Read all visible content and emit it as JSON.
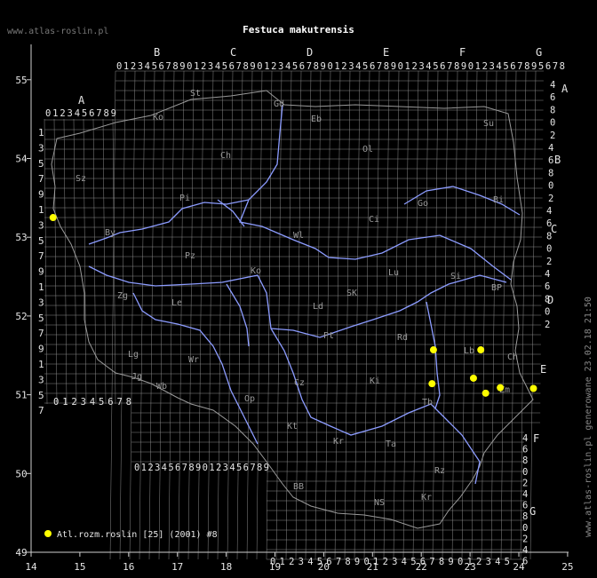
{
  "title": "Festuca makutrensis",
  "site": "www.atlas-roslin.pl",
  "credit": "www.atlas-roslin.pl generowane 23.02.18 21:50",
  "axes": {
    "x_ticks": [
      "14",
      "15",
      "16",
      "17",
      "18",
      "19",
      "20",
      "21",
      "22",
      "23",
      "24",
      "25"
    ],
    "y_ticks": [
      "55",
      "54",
      "53",
      "52",
      "51",
      "50",
      "49"
    ]
  },
  "grid_columns": {
    "top_letters": [
      "B",
      "C",
      "D",
      "E",
      "F",
      "G"
    ],
    "left_letter": "A",
    "digits": "0123456789",
    "top_tail": "5678",
    "left_tail": "012345678",
    "bottom_digits": "01234567890123456789",
    "bottom_right_digits": "01234567890123456789012345"
  },
  "grid_rows": {
    "left_labels": [
      "1",
      "3",
      "5",
      "7",
      "9",
      "1",
      "3",
      "5",
      "7",
      "9",
      "1",
      "3",
      "5",
      "7",
      "9",
      "1",
      "3",
      "5",
      "7"
    ],
    "right_letters": [
      "A",
      "B",
      "C",
      "D",
      "E",
      "F",
      "G"
    ],
    "right_column_1": [
      "4",
      "6",
      "8",
      "0",
      "2",
      "4",
      "6",
      "8",
      "0",
      "2",
      "4",
      "6",
      "8",
      "0",
      "2",
      "4",
      "6",
      "8",
      "0",
      "2"
    ],
    "right_column_2": [
      "4",
      "6",
      "8",
      "0",
      "2",
      "4",
      "6",
      "8",
      "0",
      "2",
      "4",
      "6"
    ]
  },
  "region_labels": [
    "St",
    "Ko",
    "Gd",
    "Eb",
    "Su",
    "Ch",
    "Ol",
    "Sz",
    "Pi",
    "By",
    "Ci",
    "Bi",
    "Pz",
    "Go",
    "Wl",
    "Si",
    "BP",
    "Zg",
    "Le",
    "Ko",
    "Ld",
    "SK",
    "Lu",
    "Lg",
    "Wr",
    "Pt",
    "Rd",
    "Lb",
    "Ch",
    "Jg",
    "Wb",
    "Op",
    "Cz",
    "Ki",
    "Tb",
    "Zm",
    "Kt",
    "Kr",
    "Ta",
    "Rz",
    "BB",
    "NS",
    "Kr"
  ],
  "legend": {
    "label": "Atl.rozm.roslin [25] (2001) #8",
    "color": "#ffff00"
  },
  "colors": {
    "background": "#000000",
    "grid": "#8a8a8a",
    "border": "#909090",
    "rivers": "#8c9cff",
    "text": "#e6e6e6",
    "region_text": "#9a9a9a",
    "points": "#ffff00"
  },
  "points": [
    {
      "lon": 14.45,
      "lat": 53.25
    },
    {
      "lon": 22.25,
      "lat": 51.57
    },
    {
      "lon": 23.22,
      "lat": 51.57
    },
    {
      "lon": 22.22,
      "lat": 51.14
    },
    {
      "lon": 23.07,
      "lat": 51.21
    },
    {
      "lon": 23.62,
      "lat": 51.09
    },
    {
      "lon": 23.32,
      "lat": 51.02
    },
    {
      "lon": 24.3,
      "lat": 51.08
    }
  ]
}
